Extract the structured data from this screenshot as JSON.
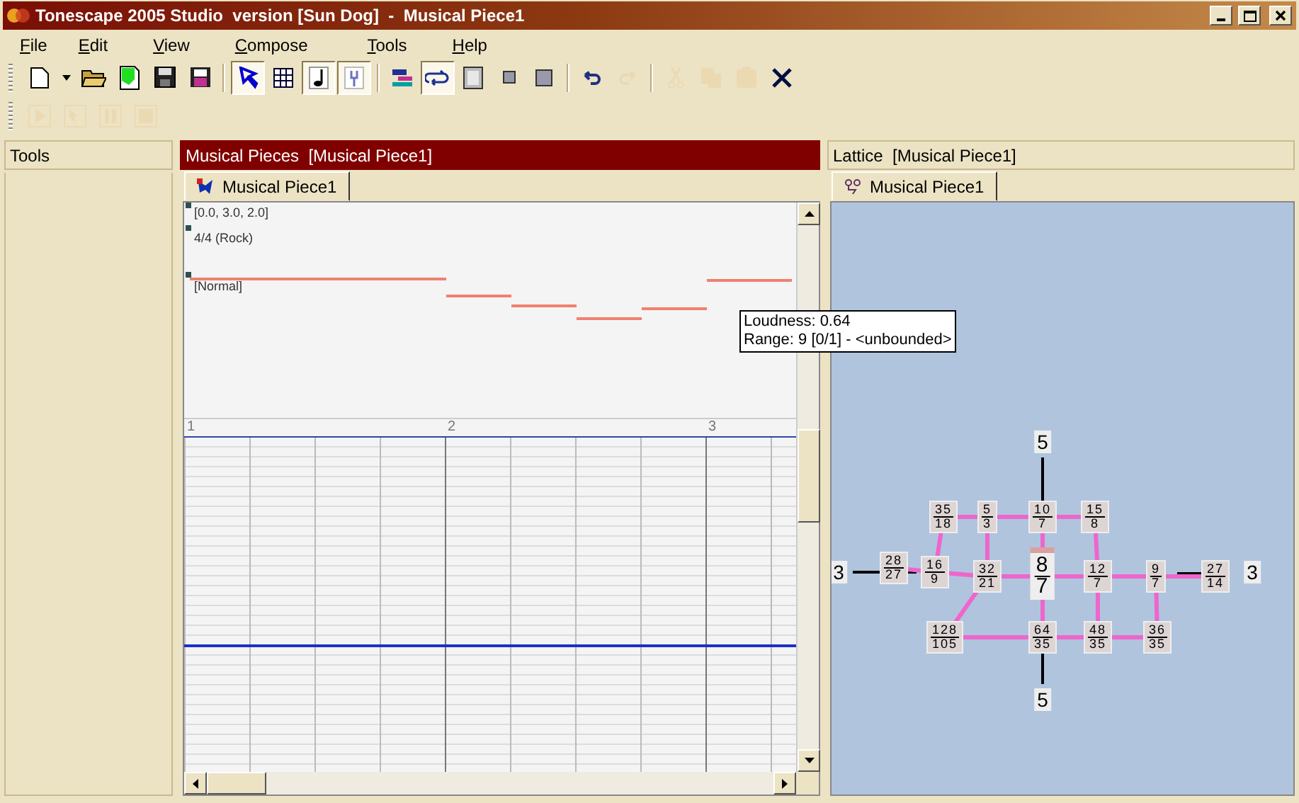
{
  "window": {
    "title": "Tonescape 2005 Studio  version [Sun Dog]  -  Musical Piece1"
  },
  "menu": [
    {
      "label": "File"
    },
    {
      "label": "Edit"
    },
    {
      "label": "View"
    },
    {
      "label": "Compose"
    },
    {
      "label": "Tools"
    },
    {
      "label": "Help"
    }
  ],
  "toolbars": [
    {
      "items": [
        {
          "kind": "new",
          "pressed": false,
          "disabled": false
        },
        {
          "kind": "dropdown",
          "pressed": false,
          "disabled": false
        },
        {
          "kind": "open",
          "pressed": false,
          "disabled": false
        },
        {
          "kind": "import",
          "pressed": false,
          "disabled": false
        },
        {
          "kind": "save",
          "pressed": false,
          "disabled": false
        },
        {
          "kind": "export",
          "pressed": false,
          "disabled": false
        },
        {
          "kind": "separator"
        },
        {
          "kind": "pointer",
          "pressed": true,
          "disabled": false
        },
        {
          "kind": "grid",
          "pressed": false,
          "disabled": false
        },
        {
          "kind": "note",
          "pressed": true,
          "disabled": false
        },
        {
          "kind": "tuner",
          "pressed": true,
          "disabled": false
        },
        {
          "kind": "separator"
        },
        {
          "kind": "tracks",
          "pressed": false,
          "disabled": false
        },
        {
          "kind": "loop",
          "pressed": true,
          "disabled": false
        },
        {
          "kind": "page",
          "pressed": false,
          "disabled": false
        },
        {
          "kind": "small-square",
          "pressed": false,
          "disabled": false
        },
        {
          "kind": "square",
          "pressed": false,
          "disabled": false
        },
        {
          "kind": "separator"
        },
        {
          "kind": "undo",
          "pressed": false,
          "disabled": false
        },
        {
          "kind": "redo",
          "pressed": false,
          "disabled": true
        },
        {
          "kind": "separator"
        },
        {
          "kind": "cut",
          "pressed": false,
          "disabled": true
        },
        {
          "kind": "copy",
          "pressed": false,
          "disabled": true
        },
        {
          "kind": "paste",
          "pressed": false,
          "disabled": true
        },
        {
          "kind": "delete",
          "pressed": false,
          "disabled": false
        }
      ]
    },
    {
      "items": [
        {
          "kind": "play",
          "pressed": false,
          "disabled": true
        },
        {
          "kind": "play-from",
          "pressed": false,
          "disabled": true
        },
        {
          "kind": "pause",
          "pressed": false,
          "disabled": true
        },
        {
          "kind": "stop",
          "pressed": false,
          "disabled": true
        }
      ]
    }
  ],
  "tools_panel": {
    "title": "Tools"
  },
  "pieces_panel": {
    "title": "Musical Pieces  [Musical Piece1]",
    "tabs": [
      {
        "label": "Musical Piece1",
        "selected": true
      }
    ],
    "track_labels": [
      "[0.0, 3.0, 2.0]",
      "4/4 (Rock)",
      "[Normal]"
    ],
    "ruler": [
      "1",
      "2",
      "3"
    ],
    "tooltip": [
      "Loudness: 0.64",
      "Range: 9 [0/1] - <unbounded>"
    ]
  },
  "lattice_panel": {
    "title": "Lattice  [Musical Piece1]",
    "tabs": [
      {
        "label": "Musical Piece1",
        "selected": true
      }
    ],
    "axis_labels": [
      "5",
      "3",
      "3",
      "5"
    ],
    "nodes": [
      {
        "num": "35",
        "den": "18"
      },
      {
        "num": "5",
        "den": "3"
      },
      {
        "num": "10",
        "den": "7"
      },
      {
        "num": "15",
        "den": "8"
      },
      {
        "num": "28",
        "den": "27"
      },
      {
        "num": "16",
        "den": "9"
      },
      {
        "num": "32",
        "den": "21"
      },
      {
        "num": "8",
        "den": "7"
      },
      {
        "num": "12",
        "den": "7"
      },
      {
        "num": "9",
        "den": "7"
      },
      {
        "num": "27",
        "den": "14"
      },
      {
        "num": "128",
        "den": "105"
      },
      {
        "num": "64",
        "den": "35"
      },
      {
        "num": "48",
        "den": "35"
      },
      {
        "num": "36",
        "den": "35"
      }
    ]
  }
}
